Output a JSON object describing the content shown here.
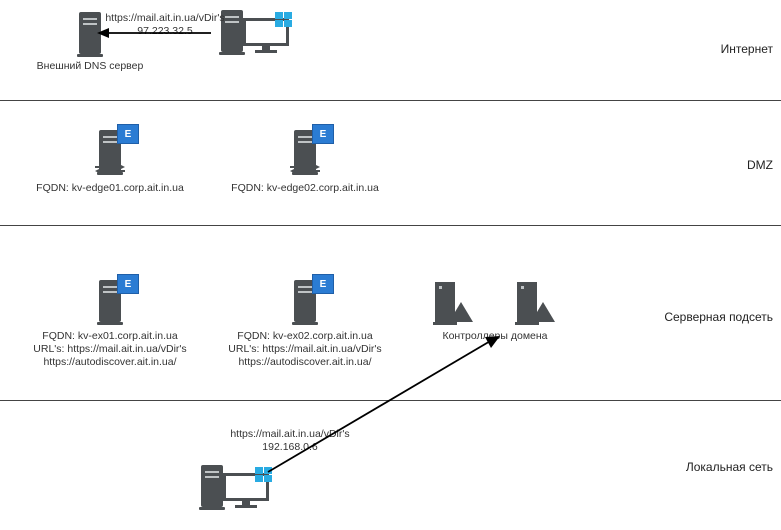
{
  "colors": {
    "gray": "#4b4f52",
    "blue": "#2b7cd3",
    "winblue": "#29abe2"
  },
  "zones": {
    "internet": {
      "label": "Интернет"
    },
    "dmz": {
      "label": "DMZ"
    },
    "servers": {
      "label": "Серверная подсеть"
    },
    "lan": {
      "label": "Локальная сеть"
    }
  },
  "internet": {
    "ext_dns": {
      "caption": "Внешний DNS сервер"
    },
    "client": {},
    "annotation": {
      "line1": "https://mail.ait.in.ua/vDir's",
      "line2": "97.223.32.5"
    }
  },
  "dmz": {
    "edge01": {
      "fqdn": "FQDN: kv-edge01.corp.ait.in.ua"
    },
    "edge02": {
      "fqdn": "FQDN: kv-edge02.corp.ait.in.ua"
    }
  },
  "servers": {
    "ex01": {
      "fqdn": "FQDN: kv-ex01.corp.ait.in.ua",
      "url": "URL's: https://mail.ait.in.ua/vDir's",
      "auto": "https://autodiscover.ait.in.ua/"
    },
    "ex02": {
      "fqdn": "FQDN: kv-ex02.corp.ait.in.ua",
      "url": "URL's: https://mail.ait.in.ua/vDir's",
      "auto": "https://autodiscover.ait.in.ua/"
    },
    "dc_label": "Контроллеры домена"
  },
  "lan": {
    "annotation": {
      "line1": "https://mail.ait.in.ua/vDir's",
      "line2": "192.168.0.6"
    }
  }
}
